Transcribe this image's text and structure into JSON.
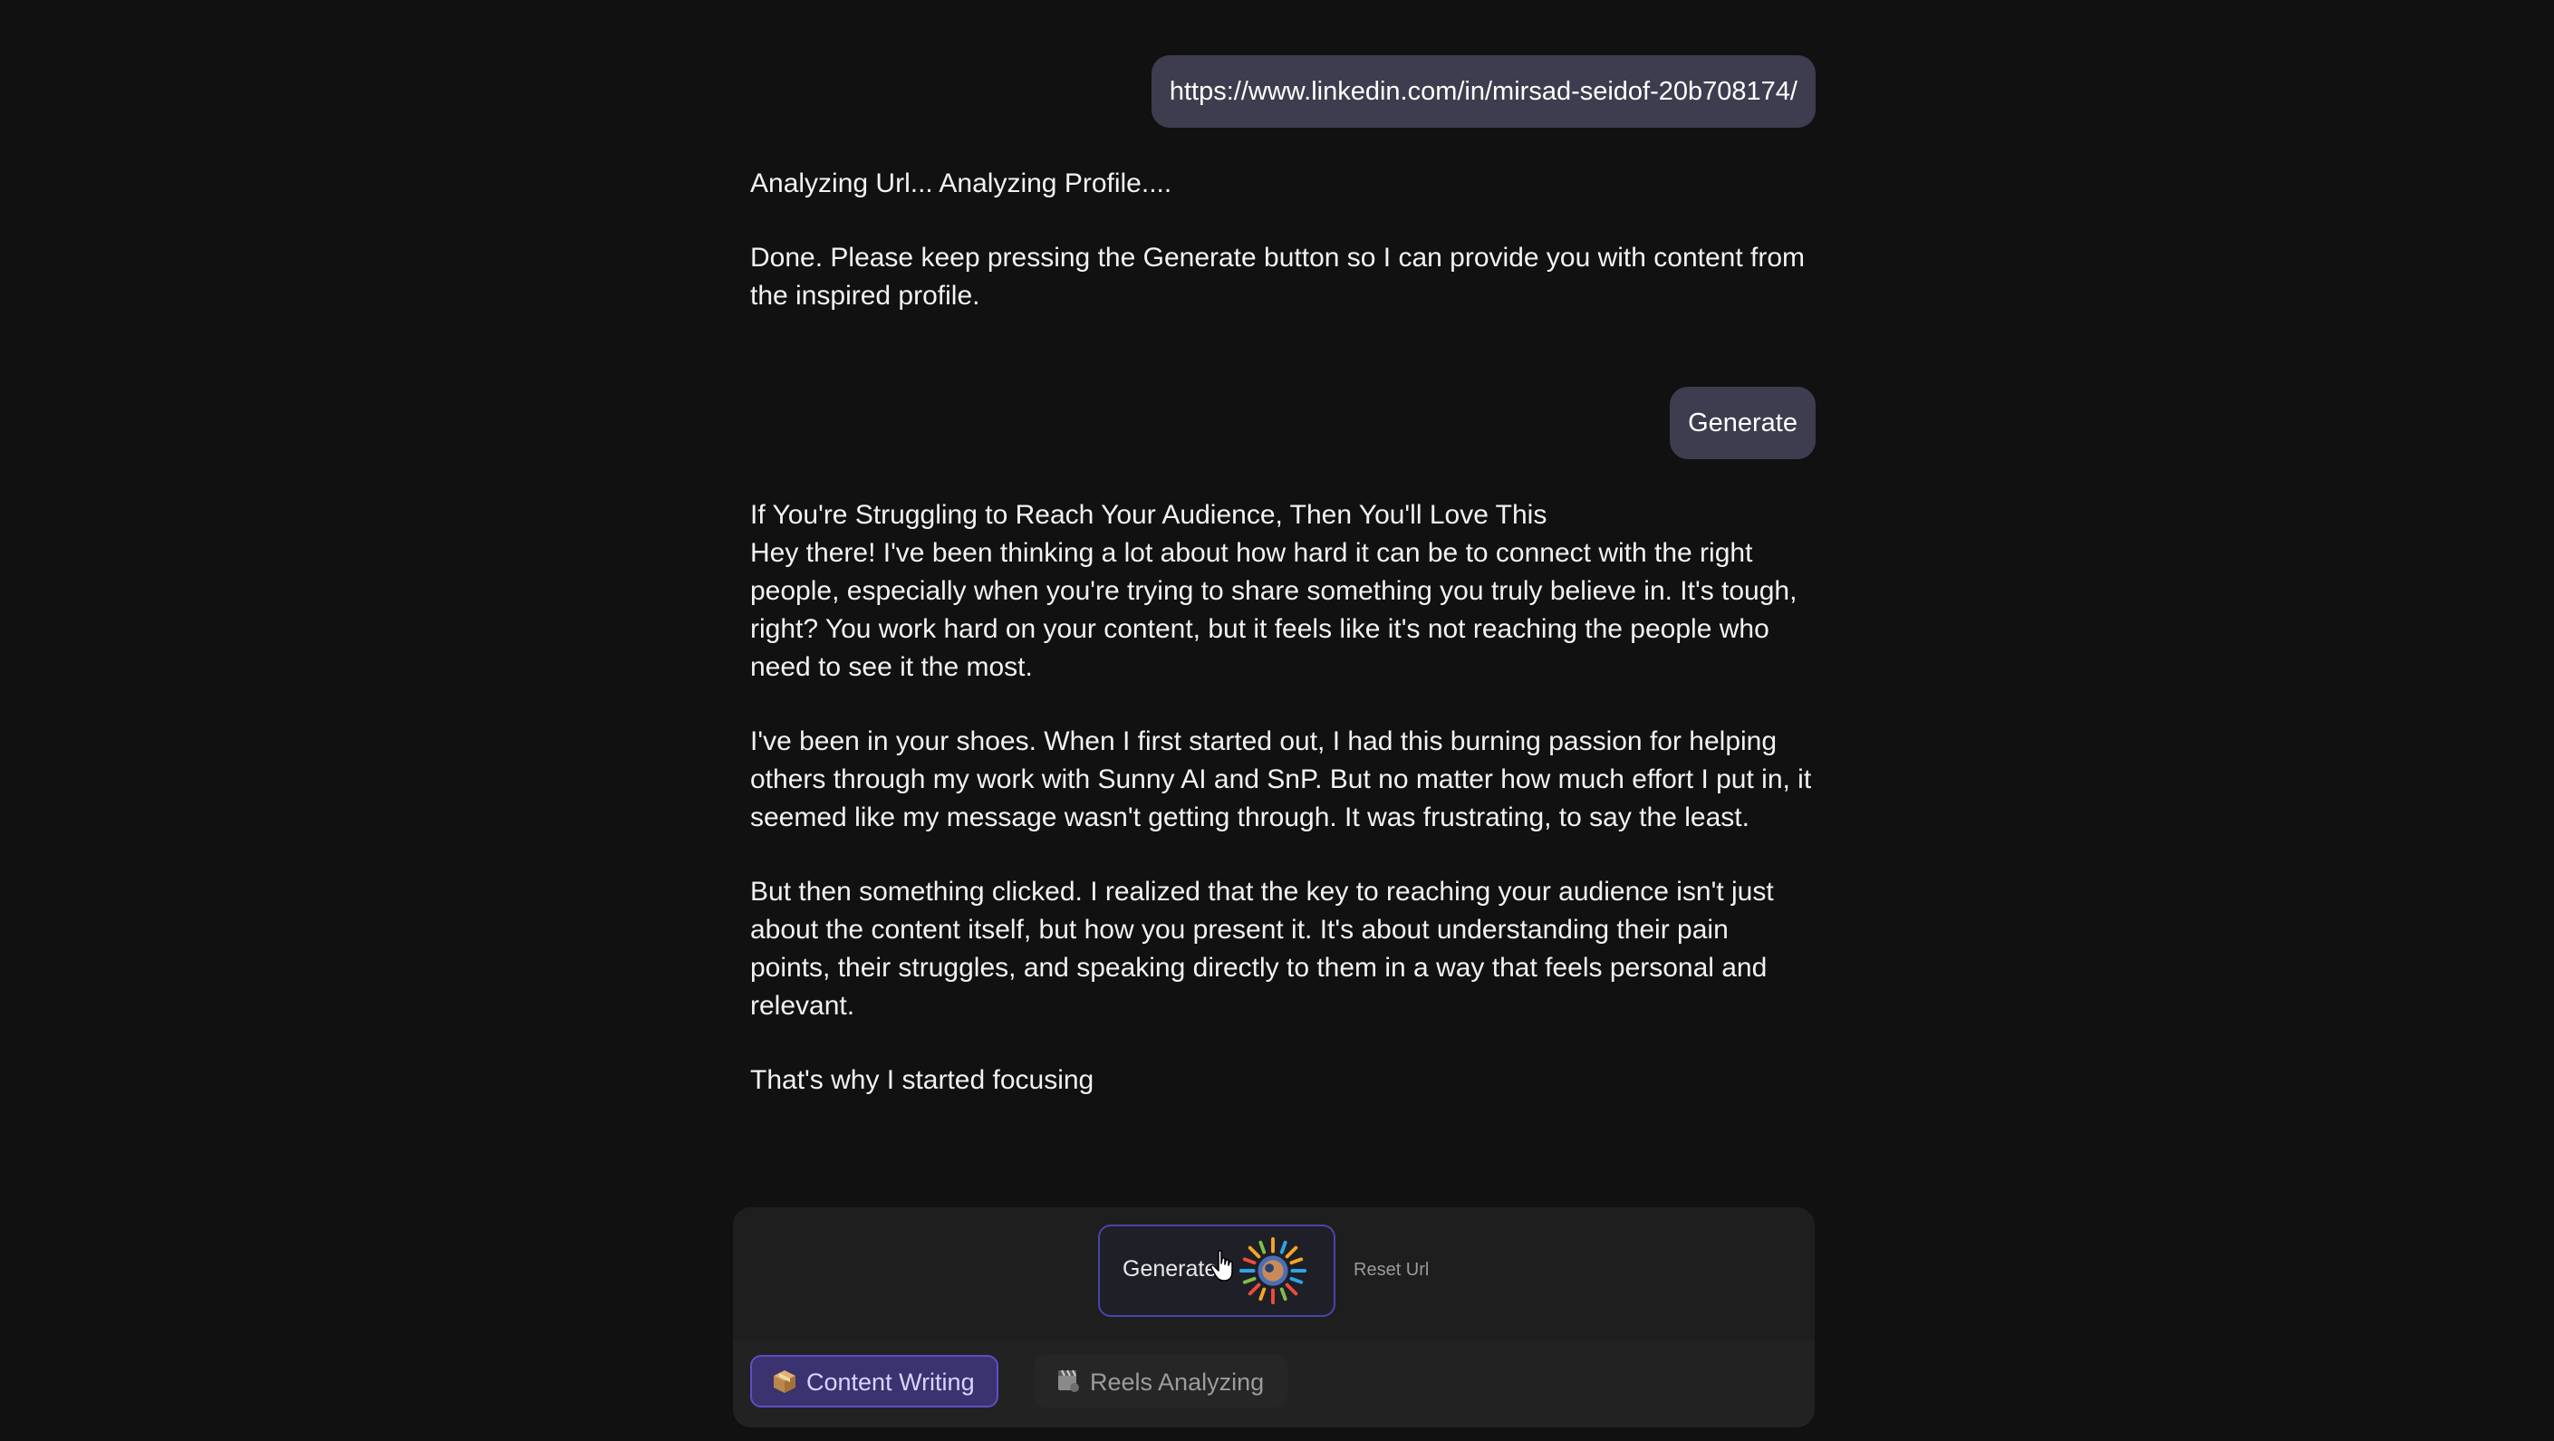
{
  "chat": {
    "user_url_message": "https://www.linkedin.com/in/mirsad-seidof-20b708174/",
    "assistant_reply_1": {
      "line_1": "Analyzing Url... Analyzing Profile....",
      "line_2": "Done. Please keep pressing the Generate button so I can provide you with content from the inspired profile."
    },
    "user_generate_message": "Generate",
    "assistant_reply_2": {
      "title": "If You're Struggling to Reach Your Audience, Then You'll Love This",
      "paragraph_1": "Hey there! I've been thinking a lot about how hard it can be to connect with the right people, especially when you're trying to share something you truly believe in. It's tough, right? You work hard on your content, but it feels like it's not reaching the people who need to see it the most.",
      "paragraph_2": "I've been in your shoes. When I first started out, I had this burning passion for helping others through my work with Sunny AI and SnP. But no matter how much effort I put in, it seemed like my message wasn't getting through. It was frustrating, to say the least.",
      "paragraph_3": "But then something clicked. I realized that the key to reaching your audience isn't just about the content itself, but how you present it. It's about understanding their pain points, their struggles, and speaking directly to them in a way that feels personal and relevant.",
      "paragraph_4": "That's why I started focusing"
    }
  },
  "composer": {
    "generate_button_label": "Generate",
    "generate_button_icon": "sun-globe-icon",
    "reset_url_label": "Reset Url"
  },
  "tabs": [
    {
      "label": "Content Writing",
      "icon": "package-icon",
      "active": true
    },
    {
      "label": "Reels Analyzing",
      "icon": "film-reel-icon",
      "active": false
    }
  ],
  "colors": {
    "background": "#111111",
    "user_bubble": "#3d3d4f",
    "accent": "#5c4fc4",
    "active_tab_bg": "#3a3370"
  }
}
